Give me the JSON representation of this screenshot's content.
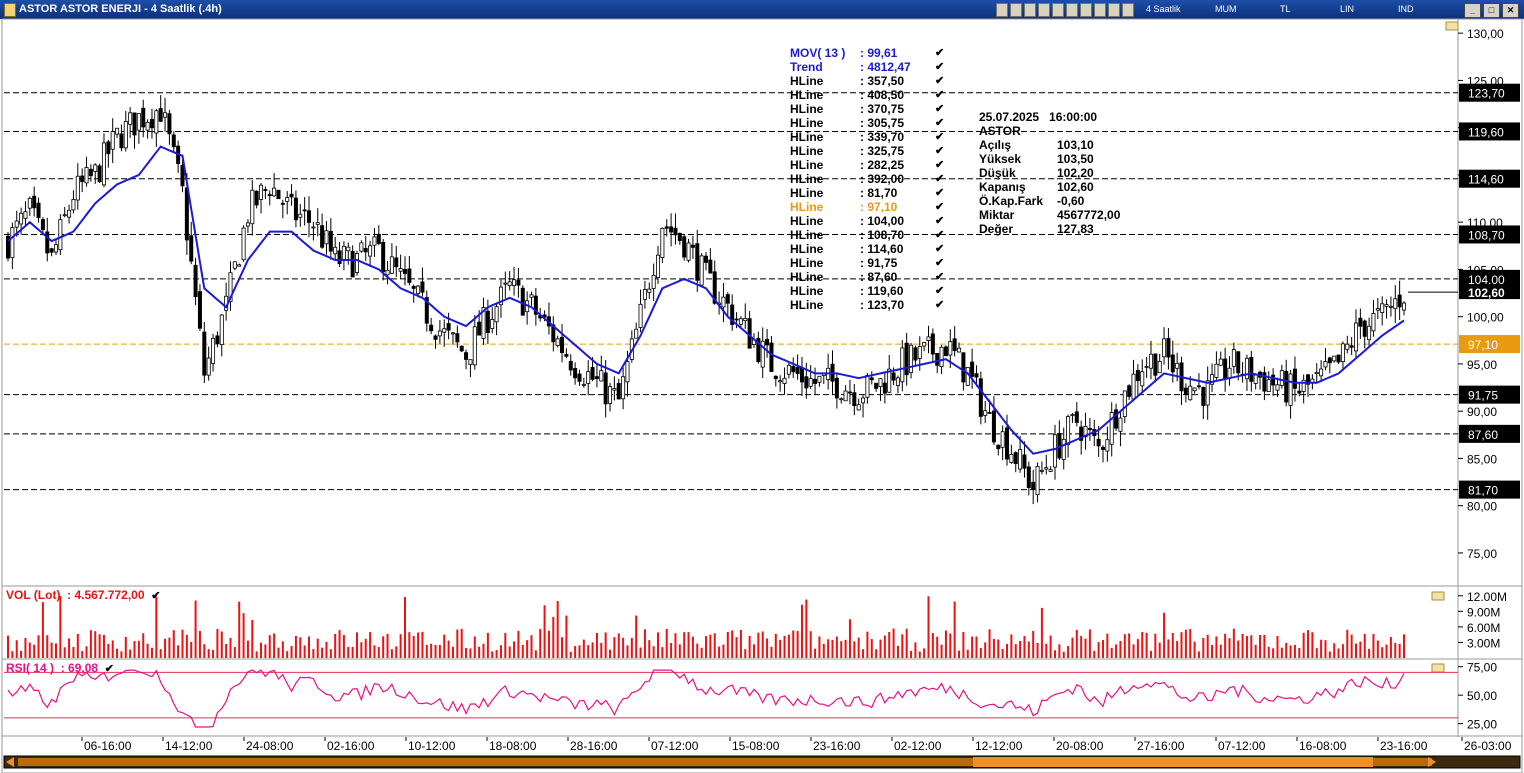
{
  "window": {
    "title": "ASTOR ASTOR ENERJI - 4 Saatlik (.4h)",
    "toolbar_labels": [
      "4 Saatlik",
      "MUM",
      "TL",
      "LIN",
      "IND"
    ],
    "buttons": [
      "_",
      "□",
      "✕"
    ]
  },
  "colors": {
    "price_line": "#1a1ad8",
    "hline": "#000000",
    "highlight_hline": "#e89a10",
    "volume": "#ee1111",
    "rsi": "#e8108a",
    "rsi_band": "#e23050"
  },
  "indicators": {
    "mov": {
      "label": "MOV( 13 )",
      "value": ": 99,61"
    },
    "trend": {
      "label": "Trend",
      "value": ": 4812,47"
    },
    "hlines": [
      {
        "label": "HLine",
        "value": ": 357,50"
      },
      {
        "label": "HLine",
        "value": ": 408,50"
      },
      {
        "label": "HLine",
        "value": ": 370,75"
      },
      {
        "label": "HLine",
        "value": ": 305,75"
      },
      {
        "label": "HLine",
        "value": ": 339,70"
      },
      {
        "label": "HLine",
        "value": ": 325,75"
      },
      {
        "label": "HLine",
        "value": ": 282,25"
      },
      {
        "label": "HLine",
        "value": ": 392,00"
      },
      {
        "label": "HLine",
        "value": ": 81,70"
      },
      {
        "label": "HLine",
        "value": ": 97,10",
        "highlight": true
      },
      {
        "label": "HLine",
        "value": ": 104,00"
      },
      {
        "label": "HLine",
        "value": ": 108,70"
      },
      {
        "label": "HLine",
        "value": ": 114,60"
      },
      {
        "label": "HLine",
        "value": ": 91,75"
      },
      {
        "label": "HLine",
        "value": ": 87,60"
      },
      {
        "label": "HLine",
        "value": ": 119,60"
      },
      {
        "label": "HLine",
        "value": ": 123,70"
      }
    ]
  },
  "info_box": {
    "datetime": "25.07.2025   16:00:00",
    "symbol": "ASTOR",
    "rows": [
      {
        "label": "Açılış",
        "value": "103,10"
      },
      {
        "label": "Yüksek",
        "value": "103,50"
      },
      {
        "label": "Düşük",
        "value": "102,20"
      },
      {
        "label": "Kapanış",
        "value": "102,60"
      },
      {
        "label": "Ö.Kap.Fark",
        "value": "-0,60"
      },
      {
        "label": "Miktar",
        "value": "4567772,00"
      },
      {
        "label": "Değer",
        "value": "127,83"
      }
    ]
  },
  "volume_header": {
    "label": "VOL (Lot)",
    "value": ": 4.567.772,00"
  },
  "rsi_header": {
    "label": "RSI( 14 )",
    "value": ": 69,08"
  },
  "chart_data": [
    {
      "type": "candlestick",
      "ylim": [
        71.5,
        131.5
      ],
      "yticks": [
        "130,00",
        "125,00",
        "120,00",
        "115,00",
        "110,00",
        "105,00",
        "100,00",
        "95,00",
        "90,00",
        "85,00",
        "80,00",
        "75,00"
      ],
      "horizontal_levels": [
        123.7,
        119.6,
        114.6,
        108.7,
        104.0,
        97.1,
        91.75,
        87.6,
        81.7
      ],
      "level_labels": [
        "123,70",
        "119,60",
        "114,60",
        "108,70",
        "104,00",
        "97,10",
        "91,75",
        "87,60",
        "81,70"
      ],
      "last_price": {
        "value": 102.6,
        "label": "102,60"
      },
      "x_tick_labels": [
        "06-16:00",
        "14-12:00",
        "24-08:00",
        "02-16:00",
        "10-12:00",
        "18-08:00",
        "28-16:00",
        "07-12:00",
        "15-08:00",
        "23-16:00",
        "02-12:00",
        "12-12:00",
        "20-08:00",
        "27-16:00",
        "07-12:00",
        "16-08:00",
        "23-16:00",
        "26-03:00"
      ],
      "close_path": [
        [
          0,
          108
        ],
        [
          5,
          111
        ],
        [
          10,
          106
        ],
        [
          15,
          113
        ],
        [
          20,
          115
        ],
        [
          25,
          119
        ],
        [
          30,
          121
        ],
        [
          35,
          122
        ],
        [
          40,
          113
        ],
        [
          45,
          94
        ],
        [
          50,
          101
        ],
        [
          55,
          111
        ],
        [
          60,
          114
        ],
        [
          65,
          111
        ],
        [
          70,
          110
        ],
        [
          75,
          106
        ],
        [
          80,
          106
        ],
        [
          85,
          107
        ],
        [
          90,
          104
        ],
        [
          95,
          101
        ],
        [
          100,
          98
        ],
        [
          105,
          96
        ],
        [
          110,
          100
        ],
        [
          115,
          103
        ],
        [
          120,
          101
        ],
        [
          125,
          98
        ],
        [
          130,
          95
        ],
        [
          135,
          93
        ],
        [
          140,
          91
        ],
        [
          145,
          100
        ],
        [
          150,
          110
        ],
        [
          155,
          108
        ],
        [
          160,
          104
        ],
        [
          165,
          101
        ],
        [
          170,
          98
        ],
        [
          175,
          95
        ],
        [
          180,
          94
        ],
        [
          185,
          93
        ],
        [
          190,
          93
        ],
        [
          195,
          92
        ],
        [
          200,
          93
        ],
        [
          205,
          95
        ],
        [
          210,
          96
        ],
        [
          215,
          97
        ],
        [
          220,
          94
        ],
        [
          225,
          89
        ],
        [
          230,
          86
        ],
        [
          235,
          82
        ],
        [
          240,
          86
        ],
        [
          245,
          89
        ],
        [
          250,
          86
        ],
        [
          255,
          91
        ],
        [
          260,
          95
        ],
        [
          265,
          96
        ],
        [
          270,
          93
        ],
        [
          275,
          92
        ],
        [
          280,
          95
        ],
        [
          285,
          94
        ],
        [
          290,
          93
        ],
        [
          295,
          92
        ],
        [
          300,
          93
        ],
        [
          305,
          95
        ],
        [
          310,
          99
        ],
        [
          315,
          100
        ],
        [
          320,
          102.6
        ]
      ],
      "moving_average": {
        "name": "MOV( 13 )",
        "points": [
          [
            0,
            108
          ],
          [
            5,
            110
          ],
          [
            10,
            108
          ],
          [
            15,
            109
          ],
          [
            20,
            112
          ],
          [
            25,
            114
          ],
          [
            30,
            115
          ],
          [
            35,
            118
          ],
          [
            40,
            117
          ],
          [
            45,
            103
          ],
          [
            50,
            101
          ],
          [
            55,
            106
          ],
          [
            60,
            109
          ],
          [
            65,
            109
          ],
          [
            70,
            107
          ],
          [
            75,
            106
          ],
          [
            80,
            106
          ],
          [
            85,
            105
          ],
          [
            90,
            103
          ],
          [
            95,
            102
          ],
          [
            100,
            100
          ],
          [
            105,
            99
          ],
          [
            110,
            101
          ],
          [
            115,
            102
          ],
          [
            120,
            101
          ],
          [
            125,
            99
          ],
          [
            130,
            97
          ],
          [
            135,
            95
          ],
          [
            140,
            94
          ],
          [
            145,
            98
          ],
          [
            150,
            103
          ],
          [
            155,
            104
          ],
          [
            160,
            103
          ],
          [
            165,
            100
          ],
          [
            170,
            98
          ],
          [
            175,
            96
          ],
          [
            180,
            95
          ],
          [
            185,
            94
          ],
          [
            190,
            94
          ],
          [
            195,
            93.5
          ],
          [
            200,
            94
          ],
          [
            205,
            94.5
          ],
          [
            210,
            95
          ],
          [
            215,
            95.5
          ],
          [
            220,
            94
          ],
          [
            225,
            91
          ],
          [
            230,
            88
          ],
          [
            235,
            85.5
          ],
          [
            240,
            86
          ],
          [
            245,
            87
          ],
          [
            250,
            88
          ],
          [
            255,
            90
          ],
          [
            260,
            92
          ],
          [
            265,
            94
          ],
          [
            270,
            93.5
          ],
          [
            275,
            93
          ],
          [
            280,
            93.5
          ],
          [
            285,
            94
          ],
          [
            290,
            93.5
          ],
          [
            295,
            93
          ],
          [
            300,
            93
          ],
          [
            305,
            94
          ],
          [
            310,
            96
          ],
          [
            315,
            98
          ],
          [
            320,
            99.6
          ]
        ]
      }
    },
    {
      "type": "bar",
      "name": "VOL (Lot)",
      "ylim": [
        0,
        13500000
      ],
      "yticks": [
        "12.00M",
        "9.00M",
        "6.00M",
        "3.00M"
      ],
      "last_value": 4567772
    },
    {
      "type": "line",
      "name": "RSI( 14 )",
      "ylim": [
        15,
        80
      ],
      "yticks": [
        "75,00",
        "50,00",
        "25,00"
      ],
      "bands": [
        70,
        30
      ],
      "last_value": 69.08
    }
  ]
}
